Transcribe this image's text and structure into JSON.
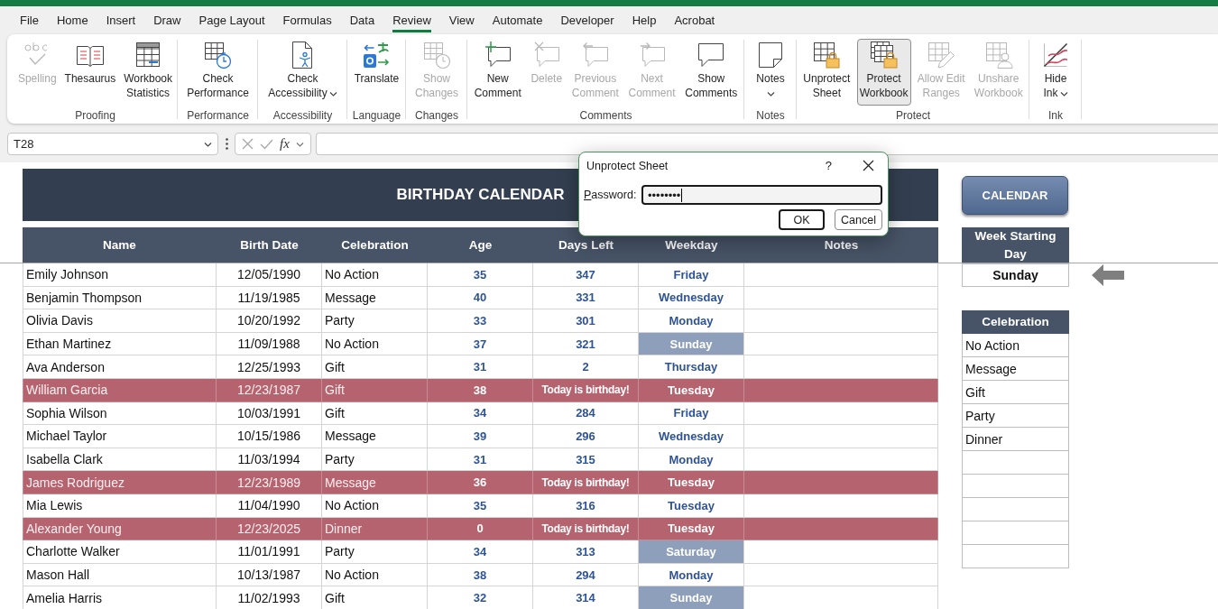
{
  "menu_tabs": [
    {
      "label": "File",
      "selected": false
    },
    {
      "label": "Home",
      "selected": false
    },
    {
      "label": "Insert",
      "selected": false
    },
    {
      "label": "Draw",
      "selected": false
    },
    {
      "label": "Page Layout",
      "selected": false
    },
    {
      "label": "Formulas",
      "selected": false
    },
    {
      "label": "Data",
      "selected": false
    },
    {
      "label": "Review",
      "selected": true
    },
    {
      "label": "View",
      "selected": false
    },
    {
      "label": "Automate",
      "selected": false
    },
    {
      "label": "Developer",
      "selected": false
    },
    {
      "label": "Help",
      "selected": false
    },
    {
      "label": "Acrobat",
      "selected": false
    }
  ],
  "ribbon": {
    "groups": [
      {
        "label": "Proofing",
        "buttons": [
          {
            "label": "Spelling",
            "disabled": true,
            "pressed": false,
            "dropdown": false
          },
          {
            "label": "Thesaurus",
            "disabled": false,
            "pressed": false,
            "dropdown": false
          },
          {
            "label": "Workbook Statistics",
            "disabled": false,
            "pressed": false,
            "dropdown": false
          }
        ]
      },
      {
        "label": "Performance",
        "buttons": [
          {
            "label": "Check Performance",
            "disabled": false,
            "pressed": false,
            "dropdown": false
          }
        ]
      },
      {
        "label": "Accessibility",
        "buttons": [
          {
            "label": "Check Accessibility",
            "disabled": false,
            "pressed": false,
            "dropdown": true
          }
        ]
      },
      {
        "label": "Language",
        "buttons": [
          {
            "label": "Translate",
            "disabled": false,
            "pressed": false,
            "dropdown": false
          }
        ]
      },
      {
        "label": "Changes",
        "buttons": [
          {
            "label": "Show Changes",
            "disabled": true,
            "pressed": false,
            "dropdown": false
          }
        ]
      },
      {
        "label": "Comments",
        "buttons": [
          {
            "label": "New Comment",
            "disabled": false,
            "pressed": false,
            "dropdown": false
          },
          {
            "label": "Delete",
            "disabled": true,
            "pressed": false,
            "dropdown": false
          },
          {
            "label": "Previous Comment",
            "disabled": true,
            "pressed": false,
            "dropdown": false
          },
          {
            "label": "Next Comment",
            "disabled": true,
            "pressed": false,
            "dropdown": false
          },
          {
            "label": "Show Comments",
            "disabled": false,
            "pressed": false,
            "dropdown": false
          }
        ]
      },
      {
        "label": "Notes",
        "buttons": [
          {
            "label": "Notes",
            "disabled": false,
            "pressed": false,
            "dropdown": true
          }
        ]
      },
      {
        "label": "Protect",
        "buttons": [
          {
            "label": "Unprotect Sheet",
            "disabled": false,
            "pressed": false,
            "dropdown": false
          },
          {
            "label": "Protect Workbook",
            "disabled": false,
            "pressed": true,
            "dropdown": false
          },
          {
            "label": "Allow Edit Ranges",
            "disabled": true,
            "pressed": false,
            "dropdown": false
          },
          {
            "label": "Unshare Workbook",
            "disabled": true,
            "pressed": false,
            "dropdown": false
          }
        ]
      },
      {
        "label": "Ink",
        "buttons": [
          {
            "label": "Hide Ink",
            "disabled": false,
            "pressed": false,
            "dropdown": true
          }
        ]
      }
    ]
  },
  "formula_bar": {
    "name_box": "T28",
    "function_button": "fx"
  },
  "sheet": {
    "title": "BIRTHDAY CALENDAR",
    "columns": [
      "Name",
      "Birth Date",
      "Celebration",
      "Age",
      "Days Left",
      "Weekday",
      "Notes"
    ],
    "rows": [
      {
        "name": "Emily Johnson",
        "birth_date": "12/05/1990",
        "celebration": "No Action",
        "age": "35",
        "days_left": "347",
        "weekday": "Friday",
        "birthday_today": false,
        "weekend": false
      },
      {
        "name": "Benjamin Thompson",
        "birth_date": "11/19/1985",
        "celebration": "Message",
        "age": "40",
        "days_left": "331",
        "weekday": "Wednesday",
        "birthday_today": false,
        "weekend": false
      },
      {
        "name": "Olivia Davis",
        "birth_date": "10/20/1992",
        "celebration": "Party",
        "age": "33",
        "days_left": "301",
        "weekday": "Monday",
        "birthday_today": false,
        "weekend": false
      },
      {
        "name": "Ethan Martinez",
        "birth_date": "11/09/1988",
        "celebration": "No Action",
        "age": "37",
        "days_left": "321",
        "weekday": "Sunday",
        "birthday_today": false,
        "weekend": true
      },
      {
        "name": "Ava Anderson",
        "birth_date": "12/25/1993",
        "celebration": "Gift",
        "age": "31",
        "days_left": "2",
        "weekday": "Thursday",
        "birthday_today": false,
        "weekend": false
      },
      {
        "name": "William Garcia",
        "birth_date": "12/23/1987",
        "celebration": "Gift",
        "age": "38",
        "days_left": "Today is birthday!",
        "weekday": "Tuesday",
        "birthday_today": true,
        "weekend": false
      },
      {
        "name": "Sophia Wilson",
        "birth_date": "10/03/1991",
        "celebration": "Gift",
        "age": "34",
        "days_left": "284",
        "weekday": "Friday",
        "birthday_today": false,
        "weekend": false
      },
      {
        "name": "Michael Taylor",
        "birth_date": "10/15/1986",
        "celebration": "Message",
        "age": "39",
        "days_left": "296",
        "weekday": "Wednesday",
        "birthday_today": false,
        "weekend": false
      },
      {
        "name": "Isabella Clark",
        "birth_date": "11/03/1994",
        "celebration": "Party",
        "age": "31",
        "days_left": "315",
        "weekday": "Monday",
        "birthday_today": false,
        "weekend": false
      },
      {
        "name": "James Rodriguez",
        "birth_date": "12/23/1989",
        "celebration": "Message",
        "age": "36",
        "days_left": "Today is birthday!",
        "weekday": "Tuesday",
        "birthday_today": true,
        "weekend": false
      },
      {
        "name": "Mia Lewis",
        "birth_date": "11/04/1990",
        "celebration": "No Action",
        "age": "35",
        "days_left": "316",
        "weekday": "Tuesday",
        "birthday_today": false,
        "weekend": false
      },
      {
        "name": "Alexander Young",
        "birth_date": "12/23/2025",
        "celebration": "Dinner",
        "age": "0",
        "days_left": "Today is birthday!",
        "weekday": "Tuesday",
        "birthday_today": true,
        "weekend": false
      },
      {
        "name": "Charlotte Walker",
        "birth_date": "11/01/1991",
        "celebration": "Party",
        "age": "34",
        "days_left": "313",
        "weekday": "Saturday",
        "birthday_today": false,
        "weekend": true
      },
      {
        "name": "Mason Hall",
        "birth_date": "10/13/1987",
        "celebration": "No Action",
        "age": "38",
        "days_left": "294",
        "weekday": "Monday",
        "birthday_today": false,
        "weekend": false
      },
      {
        "name": "Amelia Harris",
        "birth_date": "11/02/1993",
        "celebration": "Gift",
        "age": "32",
        "days_left": "314",
        "weekday": "Sunday",
        "birthday_today": false,
        "weekend": true
      }
    ],
    "calendar_button": "CALENDAR",
    "week_start": {
      "header": "Week Starting Day",
      "value": "Sunday"
    },
    "celebration_list": {
      "header": "Celebration",
      "items": [
        "No Action",
        "Message",
        "Gift",
        "Party",
        "Dinner"
      ]
    }
  },
  "dialog": {
    "title": "Unprotect Sheet",
    "help": "?",
    "password": {
      "label": "Password:",
      "value": "••••••••",
      "focused": true
    },
    "buttons": [
      {
        "label": "OK",
        "default": true
      },
      {
        "label": "Cancel",
        "default": false
      }
    ]
  }
}
